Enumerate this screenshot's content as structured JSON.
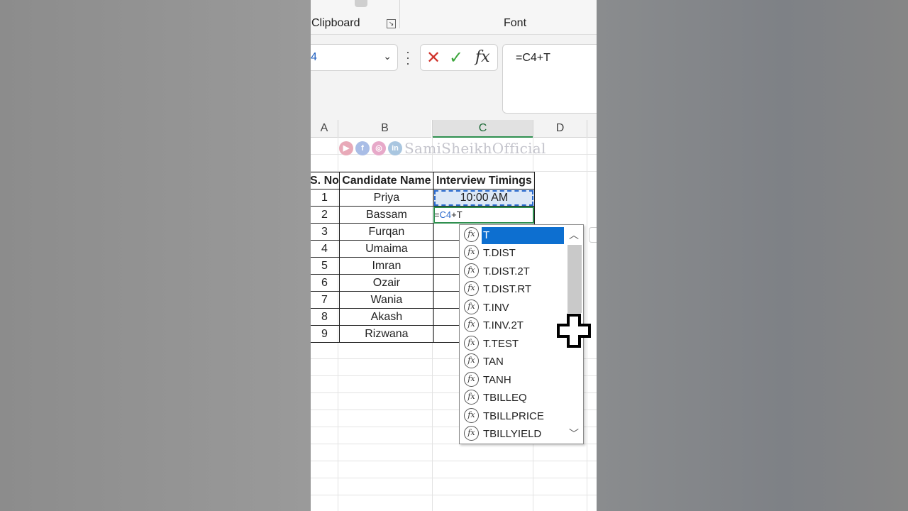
{
  "ribbon": {
    "group_clipboard": "Clipboard",
    "group_font": "Font"
  },
  "formula_bar": {
    "name_box_value": "4",
    "formula": "=C4+T"
  },
  "columns": [
    "A",
    "B",
    "C",
    "D"
  ],
  "watermark": {
    "text": "SamiSheikhOfficial",
    "icons": [
      "youtube-icon",
      "facebook-icon",
      "instagram-icon",
      "linkedin-icon"
    ]
  },
  "table": {
    "headers": [
      "S. No",
      "Candidate Name",
      "Interview Timings"
    ],
    "rows": [
      {
        "no": "1",
        "name": "Priya",
        "time": "10:00 AM"
      },
      {
        "no": "2",
        "name": "Bassam",
        "time": ""
      },
      {
        "no": "3",
        "name": "Furqan",
        "time": ""
      },
      {
        "no": "4",
        "name": "Umaima",
        "time": ""
      },
      {
        "no": "5",
        "name": "Imran",
        "time": ""
      },
      {
        "no": "6",
        "name": "Ozair",
        "time": ""
      },
      {
        "no": "7",
        "name": "Wania",
        "time": ""
      },
      {
        "no": "8",
        "name": "Akash",
        "time": ""
      },
      {
        "no": "9",
        "name": "Rizwana",
        "time": ""
      }
    ],
    "editing": {
      "prefix": "=",
      "ref": "C4",
      "suffix": "+T"
    }
  },
  "autocomplete": {
    "items": [
      "T",
      "T.DIST",
      "T.DIST.2T",
      "T.DIST.RT",
      "T.INV",
      "T.INV.2T",
      "T.TEST",
      "TAN",
      "TANH",
      "TBILLEQ",
      "TBILLPRICE",
      "TBILLYIELD"
    ],
    "selected_index": 0
  },
  "colors": {
    "accent_green": "#2f8f4f",
    "selection_blue": "#0d6fd0",
    "cancel_red": "#d0342c"
  }
}
